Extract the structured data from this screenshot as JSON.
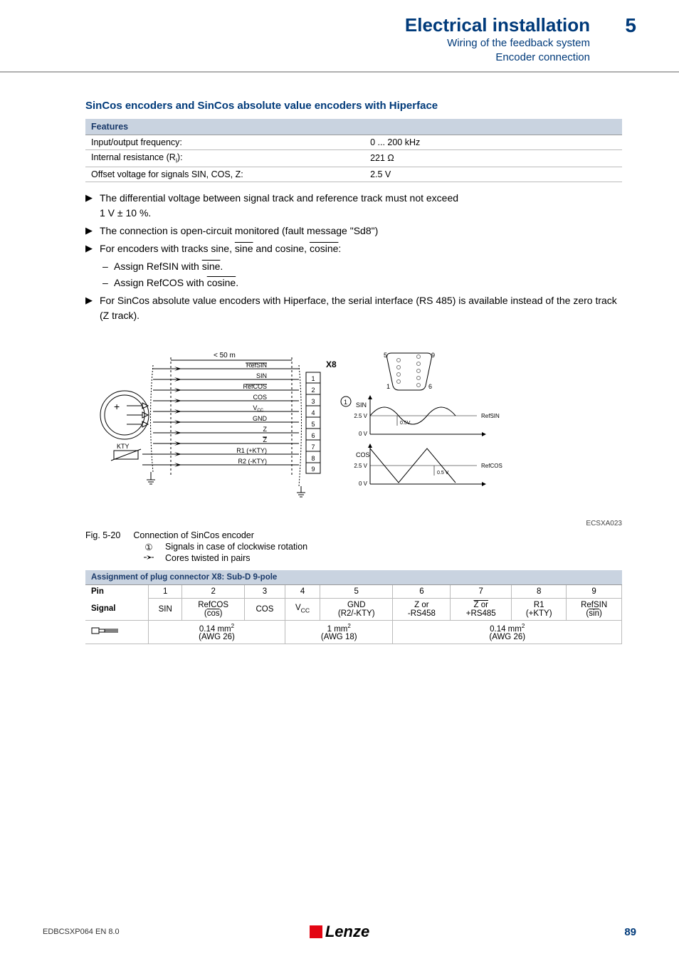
{
  "header": {
    "title": "Electrical installation",
    "sub1": "Wiring of the feedback system",
    "sub2": "Encoder connection",
    "chapter": "5"
  },
  "sec_title": "SinCos encoders and SinCos absolute value encoders with Hiperface",
  "features": {
    "head": "Features",
    "rows": [
      {
        "k": "Input/output frequency:",
        "v": "0 ... 200 kHz"
      },
      {
        "k": "Internal resistance (R",
        "k_sub": "i",
        "k_tail": "):",
        "v": "221 Ω"
      },
      {
        "k": "Offset voltage for signals SIN, COS, Z:",
        "v": "2.5 V"
      }
    ]
  },
  "bullets": {
    "b1a": "The differential voltage between signal track and reference track must not exceed",
    "b1b": "1 V ± 10 %.",
    "b2": "The connection is open-circuit monitored (fault message \"Sd8\")",
    "b3a": "For encoders with tracks sine, ",
    "b3b": " and cosine, ",
    "b3c": ":",
    "b3_over1": "sine",
    "b3_over2": "cosine",
    "s1a": "Assign RefSIN with ",
    "s1b": ".",
    "s1_over": "sine",
    "s2a": "Assign RefCOS with ",
    "s2b": ".",
    "s2_over": "cosine",
    "b4": "For SinCos absolute value encoders with Hiperface, the serial interface (RS 485) is available instead of the zero track (Z track)."
  },
  "figure": {
    "len": "< 50 m",
    "x8": "X8",
    "labels": {
      "RefSIN": "RefSIN",
      "SIN": "SIN",
      "RefCOS": "RefCOS",
      "COS": "COS",
      "Vcc": "V",
      "Vcc_sub": "CC",
      "GND": "GND",
      "Z": "Z",
      "Zbar": "Z",
      "R1": "R1 (+KTY)",
      "R2": "R2 (-KTY)",
      "KTY": "KTY"
    },
    "pins": [
      "1",
      "2",
      "3",
      "4",
      "5",
      "6",
      "7",
      "8",
      "9"
    ],
    "conn": {
      "tl": "5",
      "tr": "9",
      "bl": "1",
      "br": "6"
    },
    "wave": {
      "circ1": "①",
      "sin": "SIN",
      "cos": "COS",
      "v25": "2.5 V",
      "v0": "0 V",
      "v05": "0.5V",
      "v05b": "0.5 V",
      "refsin": "RefSIN",
      "refcos": "RefCOS"
    },
    "code": "ECSXA023",
    "cap_label": "Fig. 5-20",
    "cap_text": "Connection of SinCos encoder",
    "leg1_sym": "①",
    "leg1_txt": "Signals in case of clockwise rotation",
    "leg2_txt": "Cores twisted in pairs"
  },
  "pins_table": {
    "title": "Assignment of plug connector X8: Sub-D 9-pole",
    "pin_lbl": "Pin",
    "sig_lbl": "Signal",
    "cols": [
      "1",
      "2",
      "3",
      "4",
      "5",
      "6",
      "7",
      "8",
      "9"
    ],
    "sigs": {
      "1": "SIN",
      "2a": "RefCOS",
      "2b": "(",
      "2c": ")",
      "2over": "cos",
      "3": "COS",
      "4": "V",
      "4sub": "CC",
      "5a": "GND",
      "5b": "(R2/-KTY)",
      "6a": "Z or",
      "6b": "-RS458",
      "7a": "Z or",
      "7b": "+RS485",
      "8a": "R1",
      "8b": "(+KTY)",
      "9a": "RefSIN",
      "9b": "(",
      "9c": ")",
      "9over": "sin"
    },
    "wires": {
      "g1a": "0.14 mm",
      "g1b": "(AWG 26)",
      "g2a": "1 mm",
      "g2b": "(AWG 18)",
      "g3a": "0.14 mm",
      "g3b": "(AWG 26)"
    }
  },
  "footer": {
    "doc": "EDBCSXP064 EN 8.0",
    "brand": "Lenze",
    "page": "89"
  }
}
